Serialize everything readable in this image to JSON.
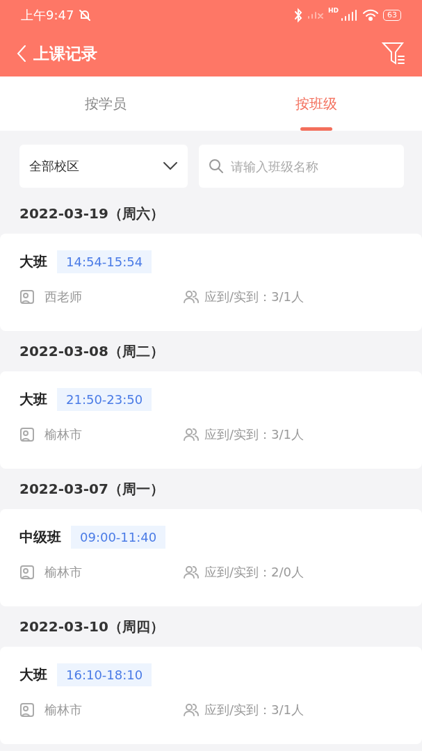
{
  "status_bar": {
    "time": "上午9:47",
    "network_label": "HD",
    "battery": "63"
  },
  "header": {
    "title": "上课记录"
  },
  "tabs": [
    {
      "label": "按学员",
      "selected": false
    },
    {
      "label": "按班级",
      "selected": true
    }
  ],
  "filters": {
    "campus": "全部校区",
    "search": {
      "placeholder": "请输入班级名称"
    }
  },
  "groups": [
    {
      "date": "2022-03-19（周六）",
      "class_name": "大班",
      "time": "14:54-15:54",
      "teacher": "西老师",
      "attendance": "应到/实到：3/1人"
    },
    {
      "date": "2022-03-08（周二）",
      "class_name": "大班",
      "time": "21:50-23:50",
      "teacher": "榆林市",
      "attendance": "应到/实到：3/1人"
    },
    {
      "date": "2022-03-07（周一）",
      "class_name": "中级班",
      "time": "09:00-11:40",
      "teacher": "榆林市",
      "attendance": "应到/实到：2/0人"
    },
    {
      "date": "2022-03-10（周四）",
      "class_name": "大班",
      "time": "16:10-18:10",
      "teacher": "榆林市",
      "attendance": "应到/实到：3/1人"
    }
  ]
}
